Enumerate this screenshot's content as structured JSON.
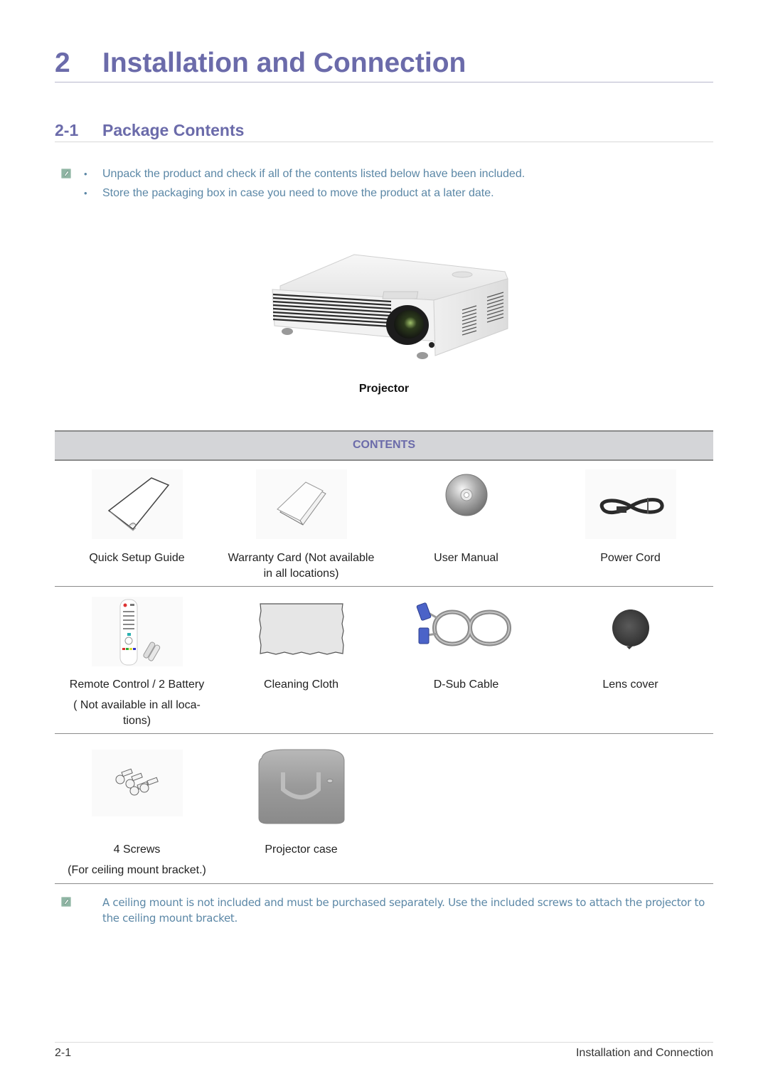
{
  "chapter": {
    "number": "2",
    "title": "Installation and Connection"
  },
  "section": {
    "number": "2-1",
    "title": "Package Contents"
  },
  "notes": {
    "icon": "note-pencil-icon",
    "bullets": [
      "Unpack the product and check if all of the contents listed below have been included.",
      "Store the packaging box in case you need to move the product at a later date."
    ],
    "bullet_glyph": "•"
  },
  "main_product": {
    "label": "Projector",
    "image": "projector-image"
  },
  "contents_table": {
    "header": "CONTENTS",
    "rows": [
      [
        {
          "label": "Quick Setup Guide",
          "image": "quick-setup-guide-image"
        },
        {
          "label": "Warranty Card (Not available",
          "label2": "in all locations)",
          "image": "warranty-card-image"
        },
        {
          "label": "User Manual",
          "image": "cd-disc-image"
        },
        {
          "label": "Power Cord",
          "image": "power-cord-image"
        }
      ],
      [
        {
          "label": "Remote Control / 2 Battery",
          "sub1": "( Not available in all loca-",
          "sub2": "tions)",
          "image": "remote-control-image"
        },
        {
          "label": "Cleaning Cloth",
          "image": "cleaning-cloth-image"
        },
        {
          "label": "D-Sub Cable",
          "image": "d-sub-cable-image"
        },
        {
          "label": "Lens cover",
          "image": "lens-cover-image"
        }
      ],
      [
        {
          "label": "4 Screws",
          "sub1": "(For ceiling mount bracket.)",
          "image": "screws-image"
        },
        {
          "label": "Projector case",
          "image": "projector-case-image"
        }
      ]
    ]
  },
  "bottom_note": "A ceiling mount is not included and must be purchased separately. Use the included screws to attach the projector to the ceiling mount bracket.",
  "footer": {
    "page": "2-1",
    "chapter": "Installation and Connection"
  },
  "colors": {
    "heading": "#6b6baa",
    "note_text": "#5b87a6",
    "table_header_bg": "#d4d5d8"
  }
}
